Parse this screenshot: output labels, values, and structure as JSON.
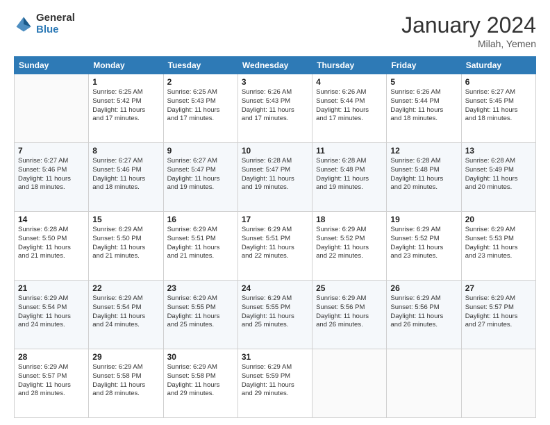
{
  "header": {
    "logo_general": "General",
    "logo_blue": "Blue",
    "title": "January 2024",
    "location": "Milah, Yemen"
  },
  "weekdays": [
    "Sunday",
    "Monday",
    "Tuesday",
    "Wednesday",
    "Thursday",
    "Friday",
    "Saturday"
  ],
  "weeks": [
    [
      {
        "day": "",
        "info": ""
      },
      {
        "day": "1",
        "info": "Sunrise: 6:25 AM\nSunset: 5:42 PM\nDaylight: 11 hours\nand 17 minutes."
      },
      {
        "day": "2",
        "info": "Sunrise: 6:25 AM\nSunset: 5:43 PM\nDaylight: 11 hours\nand 17 minutes."
      },
      {
        "day": "3",
        "info": "Sunrise: 6:26 AM\nSunset: 5:43 PM\nDaylight: 11 hours\nand 17 minutes."
      },
      {
        "day": "4",
        "info": "Sunrise: 6:26 AM\nSunset: 5:44 PM\nDaylight: 11 hours\nand 17 minutes."
      },
      {
        "day": "5",
        "info": "Sunrise: 6:26 AM\nSunset: 5:44 PM\nDaylight: 11 hours\nand 18 minutes."
      },
      {
        "day": "6",
        "info": "Sunrise: 6:27 AM\nSunset: 5:45 PM\nDaylight: 11 hours\nand 18 minutes."
      }
    ],
    [
      {
        "day": "7",
        "info": "Sunrise: 6:27 AM\nSunset: 5:46 PM\nDaylight: 11 hours\nand 18 minutes."
      },
      {
        "day": "8",
        "info": "Sunrise: 6:27 AM\nSunset: 5:46 PM\nDaylight: 11 hours\nand 18 minutes."
      },
      {
        "day": "9",
        "info": "Sunrise: 6:27 AM\nSunset: 5:47 PM\nDaylight: 11 hours\nand 19 minutes."
      },
      {
        "day": "10",
        "info": "Sunrise: 6:28 AM\nSunset: 5:47 PM\nDaylight: 11 hours\nand 19 minutes."
      },
      {
        "day": "11",
        "info": "Sunrise: 6:28 AM\nSunset: 5:48 PM\nDaylight: 11 hours\nand 19 minutes."
      },
      {
        "day": "12",
        "info": "Sunrise: 6:28 AM\nSunset: 5:48 PM\nDaylight: 11 hours\nand 20 minutes."
      },
      {
        "day": "13",
        "info": "Sunrise: 6:28 AM\nSunset: 5:49 PM\nDaylight: 11 hours\nand 20 minutes."
      }
    ],
    [
      {
        "day": "14",
        "info": "Sunrise: 6:28 AM\nSunset: 5:50 PM\nDaylight: 11 hours\nand 21 minutes."
      },
      {
        "day": "15",
        "info": "Sunrise: 6:29 AM\nSunset: 5:50 PM\nDaylight: 11 hours\nand 21 minutes."
      },
      {
        "day": "16",
        "info": "Sunrise: 6:29 AM\nSunset: 5:51 PM\nDaylight: 11 hours\nand 21 minutes."
      },
      {
        "day": "17",
        "info": "Sunrise: 6:29 AM\nSunset: 5:51 PM\nDaylight: 11 hours\nand 22 minutes."
      },
      {
        "day": "18",
        "info": "Sunrise: 6:29 AM\nSunset: 5:52 PM\nDaylight: 11 hours\nand 22 minutes."
      },
      {
        "day": "19",
        "info": "Sunrise: 6:29 AM\nSunset: 5:52 PM\nDaylight: 11 hours\nand 23 minutes."
      },
      {
        "day": "20",
        "info": "Sunrise: 6:29 AM\nSunset: 5:53 PM\nDaylight: 11 hours\nand 23 minutes."
      }
    ],
    [
      {
        "day": "21",
        "info": "Sunrise: 6:29 AM\nSunset: 5:54 PM\nDaylight: 11 hours\nand 24 minutes."
      },
      {
        "day": "22",
        "info": "Sunrise: 6:29 AM\nSunset: 5:54 PM\nDaylight: 11 hours\nand 24 minutes."
      },
      {
        "day": "23",
        "info": "Sunrise: 6:29 AM\nSunset: 5:55 PM\nDaylight: 11 hours\nand 25 minutes."
      },
      {
        "day": "24",
        "info": "Sunrise: 6:29 AM\nSunset: 5:55 PM\nDaylight: 11 hours\nand 25 minutes."
      },
      {
        "day": "25",
        "info": "Sunrise: 6:29 AM\nSunset: 5:56 PM\nDaylight: 11 hours\nand 26 minutes."
      },
      {
        "day": "26",
        "info": "Sunrise: 6:29 AM\nSunset: 5:56 PM\nDaylight: 11 hours\nand 26 minutes."
      },
      {
        "day": "27",
        "info": "Sunrise: 6:29 AM\nSunset: 5:57 PM\nDaylight: 11 hours\nand 27 minutes."
      }
    ],
    [
      {
        "day": "28",
        "info": "Sunrise: 6:29 AM\nSunset: 5:57 PM\nDaylight: 11 hours\nand 28 minutes."
      },
      {
        "day": "29",
        "info": "Sunrise: 6:29 AM\nSunset: 5:58 PM\nDaylight: 11 hours\nand 28 minutes."
      },
      {
        "day": "30",
        "info": "Sunrise: 6:29 AM\nSunset: 5:58 PM\nDaylight: 11 hours\nand 29 minutes."
      },
      {
        "day": "31",
        "info": "Sunrise: 6:29 AM\nSunset: 5:59 PM\nDaylight: 11 hours\nand 29 minutes."
      },
      {
        "day": "",
        "info": ""
      },
      {
        "day": "",
        "info": ""
      },
      {
        "day": "",
        "info": ""
      }
    ]
  ]
}
